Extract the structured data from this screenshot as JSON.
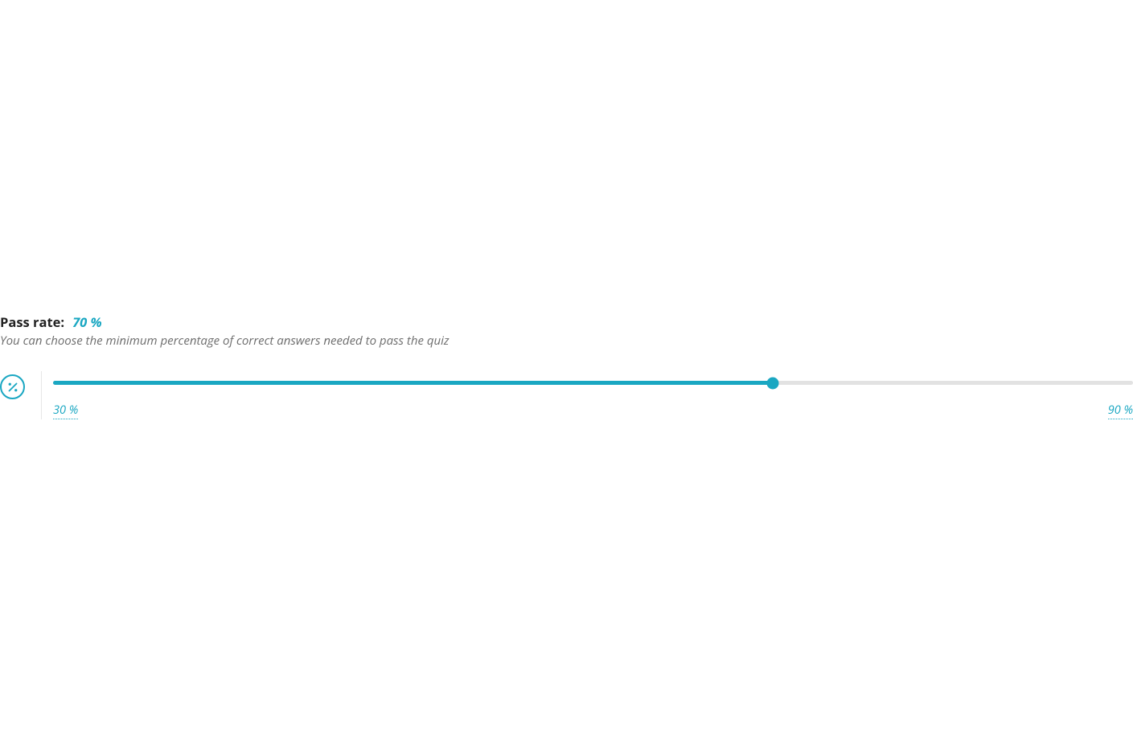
{
  "passRate": {
    "label": "Pass rate:",
    "value": "70 %",
    "description": "You can choose the minimum percentage of correct answers needed to pass the quiz",
    "min": 30,
    "max": 90,
    "current": 70,
    "minLabel": "30 %",
    "maxLabel": "90 %"
  },
  "colors": {
    "accent": "#1aa7c2",
    "trackBg": "#e2e2e2",
    "textMuted": "#6d6d6d"
  }
}
